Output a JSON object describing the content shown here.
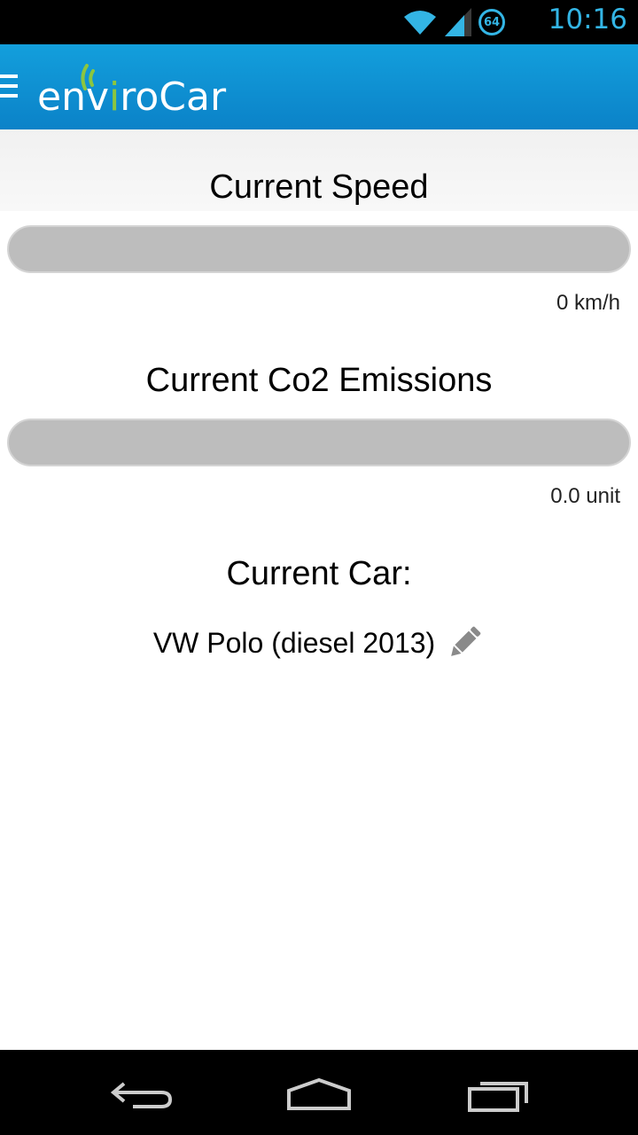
{
  "status_bar": {
    "time": "10:16",
    "badge": "64",
    "icons": [
      "wifi-icon",
      "signal-icon",
      "notification-badge"
    ]
  },
  "app_bar": {
    "app_name_prefix": "env",
    "app_name_i": "i",
    "app_name_suffix": "roCar",
    "icons": [
      "menu-icon",
      "envirocar-logo"
    ]
  },
  "speed": {
    "title": "Current Speed",
    "value_label": "0 km/h",
    "fill_fraction": 0
  },
  "emissions": {
    "title": "Current Co2 Emissions",
    "value_label": "0.0 unit",
    "fill_fraction": 0
  },
  "car": {
    "title": "Current Car:",
    "name": "VW Polo (diesel 2013)",
    "edit_icon": "pencil-icon"
  },
  "nav_bar": {
    "icons": [
      "back-icon",
      "home-icon",
      "recent-apps-icon"
    ]
  },
  "colors": {
    "accent": "#33b5e5",
    "app_bar": "#0b82c8",
    "logo_green": "#8cc63f",
    "bar_track": "#bdbdbd"
  }
}
